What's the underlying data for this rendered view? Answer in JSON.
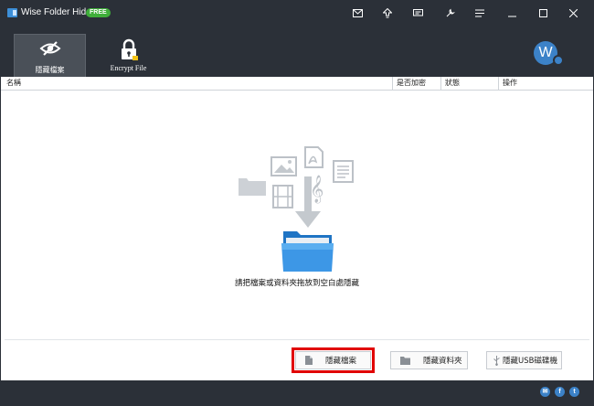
{
  "titlebar": {
    "title": "Wise Folder Hider",
    "badge": "FREE",
    "icons": [
      "mail-icon",
      "upgrade-icon",
      "feedback-icon",
      "settings-icon",
      "menu-icon",
      "minimize-icon",
      "maximize-icon",
      "close-icon"
    ]
  },
  "toolbar": {
    "tabs": [
      {
        "label": "隱藏檔案",
        "icon": "hidden-eye-icon",
        "active": true
      },
      {
        "label": "Encrypt File",
        "icon": "lock-icon",
        "active": false
      }
    ],
    "avatar_letter": "W"
  },
  "columns": [
    "名稱",
    "是否加密",
    "狀態",
    "操作"
  ],
  "empty_state": {
    "hint": "請把檔案或資料夾拖放到空白處隱藏"
  },
  "footer": {
    "buttons": [
      {
        "label": "隱藏檔案",
        "icon": "file-icon",
        "highlighted": true
      },
      {
        "label": "隱藏資料夾",
        "icon": "folder-icon",
        "highlighted": false
      },
      {
        "label": "隱藏USB磁碟機",
        "icon": "usb-icon",
        "highlighted": false
      }
    ]
  },
  "statusbar": {
    "social": [
      {
        "icon": "email-icon",
        "glyph": "✉"
      },
      {
        "icon": "facebook-icon",
        "glyph": "f"
      },
      {
        "icon": "twitter-icon",
        "glyph": "t"
      }
    ]
  },
  "colors": {
    "chrome": "#2b3038",
    "accent": "#3c82c8",
    "badge": "#3fae3a",
    "highlight_box": "#e10000"
  }
}
